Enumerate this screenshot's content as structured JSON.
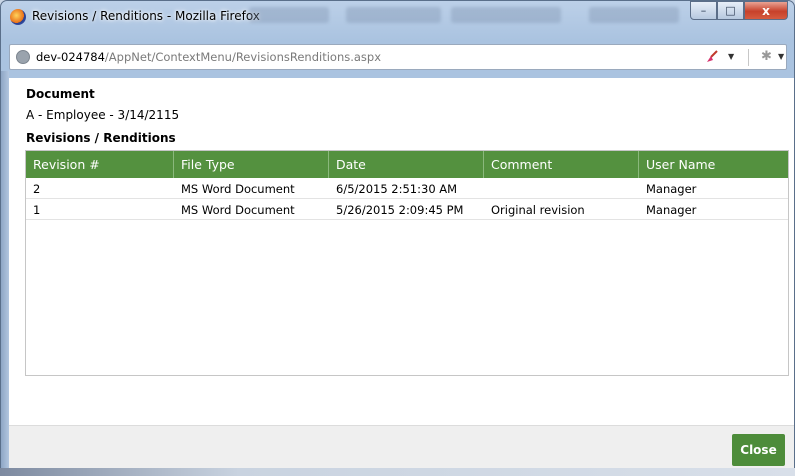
{
  "window": {
    "title": "Revisions / Renditions - Mozilla Firefox",
    "minimize_label": "–",
    "maximize_label": "□",
    "close_label": "x"
  },
  "address": {
    "host": "dev-024784",
    "path": "/AppNet/ContextMenu/RevisionsRenditions.aspx"
  },
  "icons": {
    "page": "globe-icon",
    "addon": "broom-icon",
    "extension": "star-icon"
  },
  "document": {
    "heading": "Document",
    "name": "A - Employee - 3/14/2115"
  },
  "revisions": {
    "heading": "Revisions / Renditions",
    "columns": [
      "Revision #",
      "File Type",
      "Date",
      "Comment",
      "User Name"
    ],
    "rows": [
      [
        "2",
        "MS Word Document",
        "6/5/2015 2:51:30 AM",
        "",
        "Manager"
      ],
      [
        "1",
        "MS Word Document",
        "5/26/2015 2:09:45 PM",
        "Original revision",
        "Manager"
      ]
    ]
  },
  "footer": {
    "close_label": "Close"
  },
  "colors": {
    "header_green": "#54913f",
    "button_green": "#4d8c3a"
  }
}
